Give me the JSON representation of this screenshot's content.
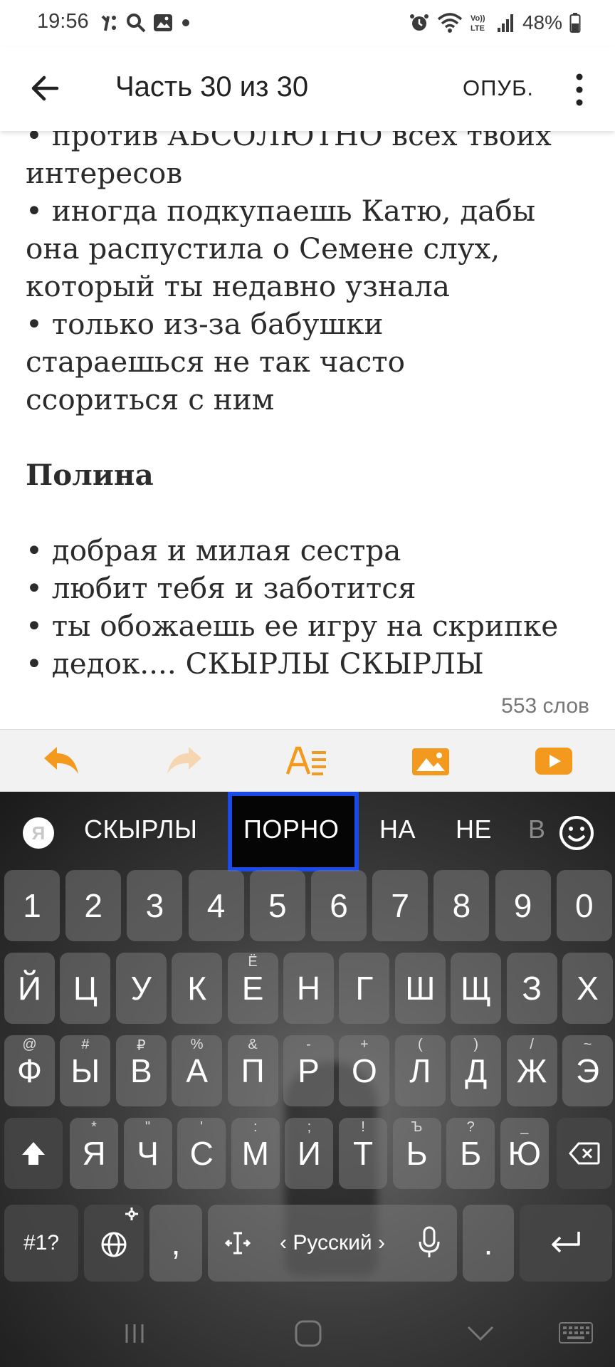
{
  "status_bar": {
    "time": "19:56",
    "battery": "48%",
    "left_icons": [
      "notification-icon",
      "search-icon",
      "gallery-icon",
      "dot-icon"
    ],
    "right_icons": [
      "alarm-icon",
      "wifi-icon",
      "volte-icon",
      "signal-icon",
      "battery-icon"
    ]
  },
  "app_bar": {
    "title": "Часть 30 из 30",
    "publish_label": "ОПУБ."
  },
  "content": {
    "lines": [
      {
        "text": "• против АБСОЛЮТНО всех твоих",
        "bold": false
      },
      {
        "text": "интересов",
        "bold": false
      },
      {
        "text": "• иногда подкупаешь Катю, дабы",
        "bold": false
      },
      {
        "text": "она распустила о Семене слух,",
        "bold": false
      },
      {
        "text": "который ты недавно узнала",
        "bold": false
      },
      {
        "text": "• только из-за бабушки",
        "bold": false
      },
      {
        "text": "стараешься не так часто",
        "bold": false
      },
      {
        "text": "ссориться с ним",
        "bold": false
      },
      {
        "text": "",
        "bold": false
      },
      {
        "text": "Полина",
        "bold": true
      },
      {
        "text": "",
        "bold": false
      },
      {
        "text": "• добрая и милая сестра",
        "bold": false
      },
      {
        "text": "• любит тебя и заботится",
        "bold": false
      },
      {
        "text": "• ты обожаешь ее игру на скрипке",
        "bold": false
      },
      {
        "text": "• дедок.... СКЫРЛЫ СКЫРЛЫ",
        "bold": false
      }
    ],
    "word_count": "553 слов"
  },
  "toolbar": {
    "accent": "#f39a1e",
    "items": [
      "undo-icon",
      "redo-icon",
      "text-format-icon",
      "image-icon",
      "video-icon"
    ]
  },
  "keyboard": {
    "yandex_label": "Я",
    "suggestions": [
      "СКЫРЛЫ",
      "ПОРНО",
      "НА",
      "НЕ",
      "В"
    ],
    "number_row": [
      "1",
      "2",
      "3",
      "4",
      "5",
      "6",
      "7",
      "8",
      "9",
      "0"
    ],
    "row1": [
      {
        "k": "Й",
        "s": ""
      },
      {
        "k": "Ц",
        "s": ""
      },
      {
        "k": "У",
        "s": ""
      },
      {
        "k": "К",
        "s": ""
      },
      {
        "k": "Е",
        "s": "Ё"
      },
      {
        "k": "Н",
        "s": ""
      },
      {
        "k": "Г",
        "s": ""
      },
      {
        "k": "Ш",
        "s": ""
      },
      {
        "k": "Щ",
        "s": ""
      },
      {
        "k": "З",
        "s": ""
      },
      {
        "k": "Х",
        "s": ""
      }
    ],
    "row2": [
      {
        "k": "Ф",
        "s": "@"
      },
      {
        "k": "Ы",
        "s": "#"
      },
      {
        "k": "В",
        "s": "₽"
      },
      {
        "k": "А",
        "s": "%"
      },
      {
        "k": "П",
        "s": "&"
      },
      {
        "k": "Р",
        "s": "-"
      },
      {
        "k": "О",
        "s": "+"
      },
      {
        "k": "Л",
        "s": "("
      },
      {
        "k": "Д",
        "s": ")"
      },
      {
        "k": "Ж",
        "s": "/"
      },
      {
        "k": "Э",
        "s": "~"
      }
    ],
    "row3": [
      {
        "k": "Я",
        "s": "*"
      },
      {
        "k": "Ч",
        "s": "\""
      },
      {
        "k": "С",
        "s": "'"
      },
      {
        "k": "М",
        "s": ":"
      },
      {
        "k": "И",
        "s": ";"
      },
      {
        "k": "Т",
        "s": "!"
      },
      {
        "k": "Ь",
        "s": "Ъ"
      },
      {
        "k": "Б",
        "s": "?"
      },
      {
        "k": "Ю",
        "s": "_"
      }
    ],
    "symbols_label": "#1?",
    "comma": ",",
    "space_label": "‹ Русский ›",
    "period": "."
  }
}
